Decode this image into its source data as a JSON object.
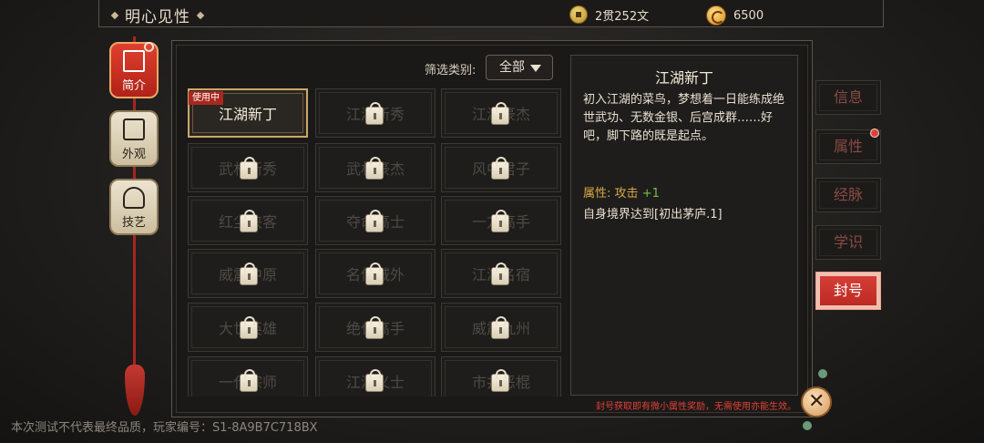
{
  "header": {
    "title": "明心见性",
    "copper": "2贯252文",
    "gold": "6500"
  },
  "side_tabs": [
    {
      "label": "简介",
      "icon": "book-icon",
      "active": true
    },
    {
      "label": "外观",
      "icon": "frame-icon",
      "active": false
    },
    {
      "label": "技艺",
      "icon": "instrument-icon",
      "active": false
    }
  ],
  "filter": {
    "label": "筛选类别:",
    "selected": "全部"
  },
  "titles": [
    {
      "name": "江湖新丁",
      "state": "active",
      "badge": "使用中"
    },
    {
      "name": "江湖新秀",
      "state": "locked"
    },
    {
      "name": "江湖豪杰",
      "state": "locked"
    },
    {
      "name": "武林新秀",
      "state": "locked"
    },
    {
      "name": "武林豪杰",
      "state": "locked"
    },
    {
      "name": "风中君子",
      "state": "locked"
    },
    {
      "name": "红尘侠客",
      "state": "locked"
    },
    {
      "name": "夺命高士",
      "state": "locked"
    },
    {
      "name": "一方高手",
      "state": "locked"
    },
    {
      "name": "威震中原",
      "state": "locked"
    },
    {
      "name": "名传域外",
      "state": "locked"
    },
    {
      "name": "江湖名宿",
      "state": "locked"
    },
    {
      "name": "大世英雄",
      "state": "locked"
    },
    {
      "name": "绝代高手",
      "state": "locked"
    },
    {
      "name": "威震九州",
      "state": "locked"
    },
    {
      "name": "一代宗师",
      "state": "locked"
    },
    {
      "name": "江湖义士",
      "state": "locked"
    },
    {
      "name": "市井恶棍",
      "state": "locked"
    }
  ],
  "detail": {
    "title": "江湖新丁",
    "description": "初入江湖的菜鸟，梦想着一日能练成绝世武功、无数金银、后宫成群……好吧，脚下路的既是起点。",
    "attr_label": "属性:",
    "attr_name": "攻击",
    "attr_value": "+1",
    "effect": "自身境界达到[初出茅庐.1]",
    "note": "封号获取即有微小属性奖励，无需使用亦能生效。"
  },
  "right_tabs": [
    {
      "label": "信息",
      "active": false
    },
    {
      "label": "属性",
      "active": false,
      "dot": true
    },
    {
      "label": "经脉",
      "active": false
    },
    {
      "label": "学识",
      "active": false
    },
    {
      "label": "封号",
      "active": true
    }
  ],
  "footer": {
    "watermark": "本次测试不代表最终品质，玩家编号：S1-8A9B7C718BX"
  },
  "colors": {
    "accent_red": "#c8302a",
    "gold": "#c9a86a",
    "attr_orange": "#d8a84a",
    "attr_green": "#6cc24a"
  }
}
